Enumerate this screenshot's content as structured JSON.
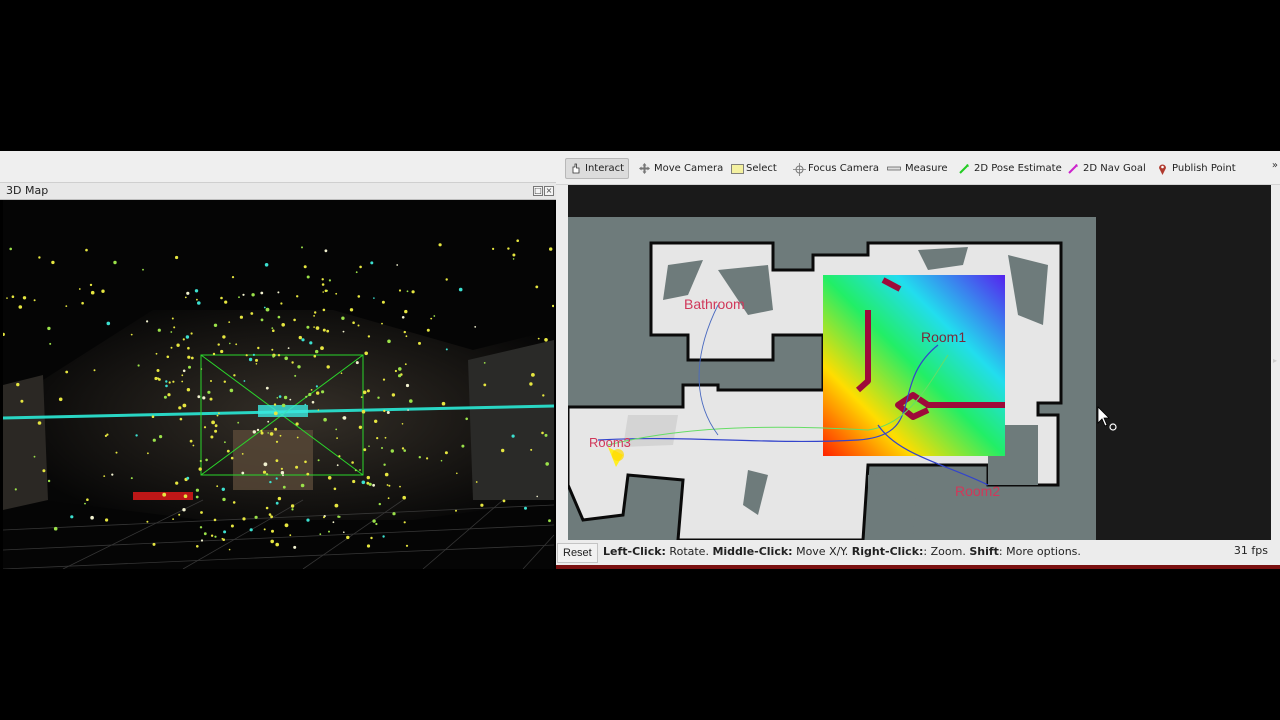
{
  "left_panel": {
    "title": "3D Map"
  },
  "toolbar": {
    "tools": [
      {
        "label": "Interact",
        "icon": "hand-pointer-icon",
        "active": true
      },
      {
        "label": "Move Camera",
        "icon": "move-arrows-icon",
        "active": false
      },
      {
        "label": "Select",
        "icon": "select-box-icon",
        "active": false
      },
      {
        "label": "Focus Camera",
        "icon": "focus-target-icon",
        "active": false
      },
      {
        "label": "Measure",
        "icon": "ruler-icon",
        "active": false
      },
      {
        "label": "2D Pose Estimate",
        "icon": "green-arrow-icon",
        "active": false
      },
      {
        "label": "2D Nav Goal",
        "icon": "magenta-arrow-icon",
        "active": false
      },
      {
        "label": "Publish Point",
        "icon": "map-pin-icon",
        "active": false
      }
    ],
    "more": "»"
  },
  "map": {
    "labels": {
      "bathroom": "Bathroom",
      "room1": "Room1",
      "room2": "Room2",
      "room3": "Room3"
    }
  },
  "status": {
    "reset": "Reset",
    "help_left_key": "Left-Click:",
    "help_left": " Rotate. ",
    "help_middle_key": "Middle-Click:",
    "help_middle": " Move X/Y. ",
    "help_right_key": "Right-Click:",
    "help_right": ": Zoom. ",
    "help_shift_key": "Shift",
    "help_shift": ": More options.",
    "fps": "31 fps"
  },
  "colors": {
    "status_accent": "#7a1010",
    "map_free": "#e6e6e6",
    "map_unknown": "#6e7b7b",
    "path_blue": "#3344cc"
  }
}
